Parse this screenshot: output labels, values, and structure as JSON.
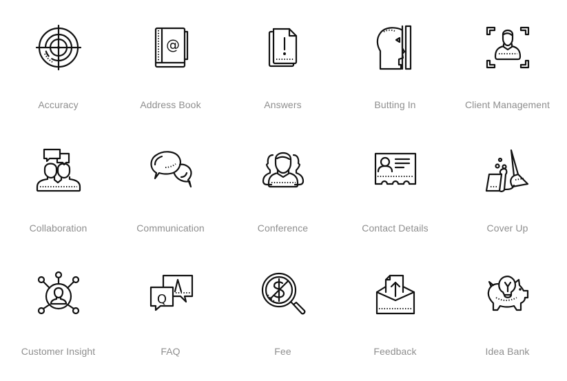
{
  "page": {
    "background": "#ffffff",
    "label_color": "#8e8e8e",
    "icon_color": "#111111"
  },
  "icons": [
    {
      "label": "Accuracy",
      "icon": "target-crosshair-icon"
    },
    {
      "label": "Address Book",
      "icon": "address-book-icon"
    },
    {
      "label": "Answers",
      "icon": "document-exclamation-icon"
    },
    {
      "label": "Butting In",
      "icon": "head-wall-icon"
    },
    {
      "label": "Client Management",
      "icon": "client-frame-icon"
    },
    {
      "label": "Collaboration",
      "icon": "people-chat-icon"
    },
    {
      "label": "Communication",
      "icon": "speech-bubbles-icon"
    },
    {
      "label": "Conference",
      "icon": "group-people-icon"
    },
    {
      "label": "Contact Details",
      "icon": "id-card-icon"
    },
    {
      "label": "Cover Up",
      "icon": "broom-carpet-icon"
    },
    {
      "label": "Customer Insight",
      "icon": "customer-network-icon"
    },
    {
      "label": "FAQ",
      "icon": "question-answer-icon"
    },
    {
      "label": "Fee",
      "icon": "dollar-search-icon"
    },
    {
      "label": "Feedback",
      "icon": "envelope-upload-icon"
    },
    {
      "label": "Idea Bank",
      "icon": "piggy-bulb-icon"
    }
  ]
}
